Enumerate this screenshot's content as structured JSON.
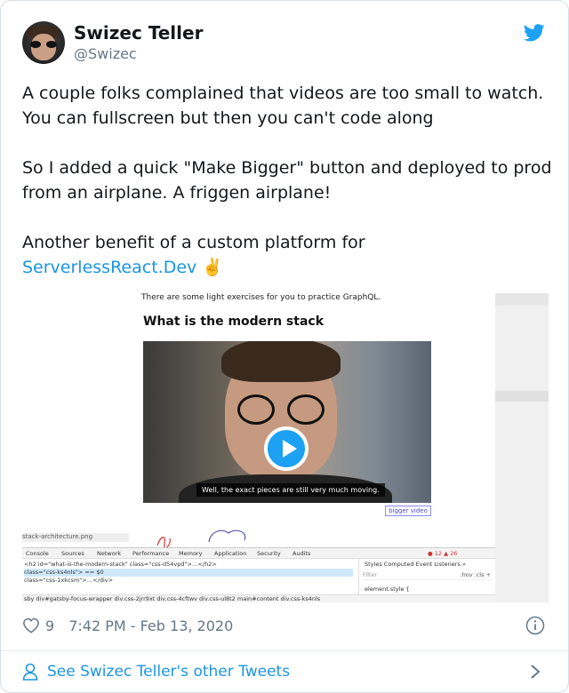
{
  "header": {
    "display_name": "Swizec Teller",
    "handle": "@Swizec"
  },
  "tweet": {
    "para1": "A couple folks complained that videos are too small to watch. You can fullscreen but then you can't code along",
    "para2": "So I added a quick \"Make Bigger\" button and deployed to prod from an airplane. A friggen airplane!",
    "para3_prefix": "Another benefit of a custom platform for",
    "link_text": "ServerlessReact.Dev",
    "emoji": "✌️"
  },
  "media": {
    "page_hint": "There are some light exercises for you to practice GraphQL.",
    "page_title": "What is the modern stack",
    "video_caption": "Well, the exact pieces are still very much moving.",
    "bigger_button": "bigger video",
    "sketch_label": "stack-architecture.png",
    "devtools": {
      "tabs": [
        "Console",
        "Sources",
        "Network",
        "Performance",
        "Memory",
        "Application",
        "Security",
        "Audits"
      ],
      "counts": "● 12 ▲ 26",
      "lines": [
        "<h2 id=\"what-is-the-modern-stack\" class=\"css-d54vpd\">…</h2>",
        "class=\"css-ks4nls\"> == $0",
        "class=\"css-1xkcsm\">…</div>"
      ],
      "styles_tabs": "Styles   Computed   Event Listeners   »",
      "filter": "Filter",
      "filter_right": ":hov  .cls  +",
      "element_style": "element.style {",
      "breadcrumb": "sby   div#gatsby-focus-wrapper   div.css-2jrr9xt   div.css-4cftwv   div.css-ul8t2   main#content   div.css-ks4nls"
    }
  },
  "footer": {
    "likes": "9",
    "timestamp": "7:42 PM - Feb 13, 2020",
    "see_more": "See Swizec Teller's other Tweets"
  },
  "colors": {
    "link": "#1b95e0",
    "twitter_blue": "#1da1f2",
    "meta_gray": "#657786"
  }
}
